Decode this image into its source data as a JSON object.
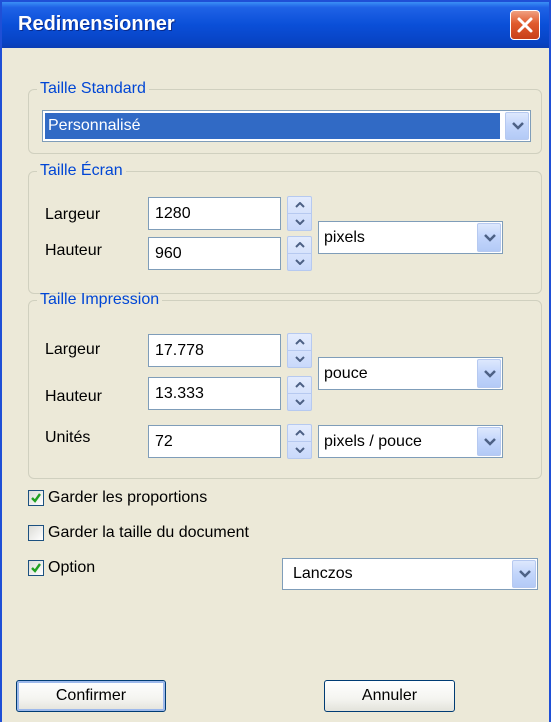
{
  "window": {
    "title": "Redimensionner"
  },
  "standard": {
    "legend": "Taille Standard",
    "selected": "Personnalisé"
  },
  "screen": {
    "legend": "Taille Écran",
    "width_label": "Largeur",
    "width_value": "1280",
    "height_label": "Hauteur",
    "height_value": "960",
    "unit": "pixels"
  },
  "print": {
    "legend": "Taille Impression",
    "width_label": "Largeur",
    "width_value": "17.778",
    "height_label": "Hauteur",
    "height_value": "13.333",
    "unit": "pouce",
    "res_label": "Unités",
    "res_value": "72",
    "res_unit": "pixels / pouce"
  },
  "options": {
    "keep_ratio": {
      "label": "Garder les proportions",
      "checked": true
    },
    "keep_doc_size": {
      "label": "Garder la taille du document",
      "checked": false
    },
    "option": {
      "label": "Option",
      "checked": true
    },
    "filter": "Lanczos"
  },
  "buttons": {
    "confirm": "Confirmer",
    "cancel": "Annuler"
  },
  "colors": {
    "titlebar": "#0a4fd8",
    "legend": "#0046d5",
    "selection": "#316ac5",
    "face": "#ece9d8"
  }
}
